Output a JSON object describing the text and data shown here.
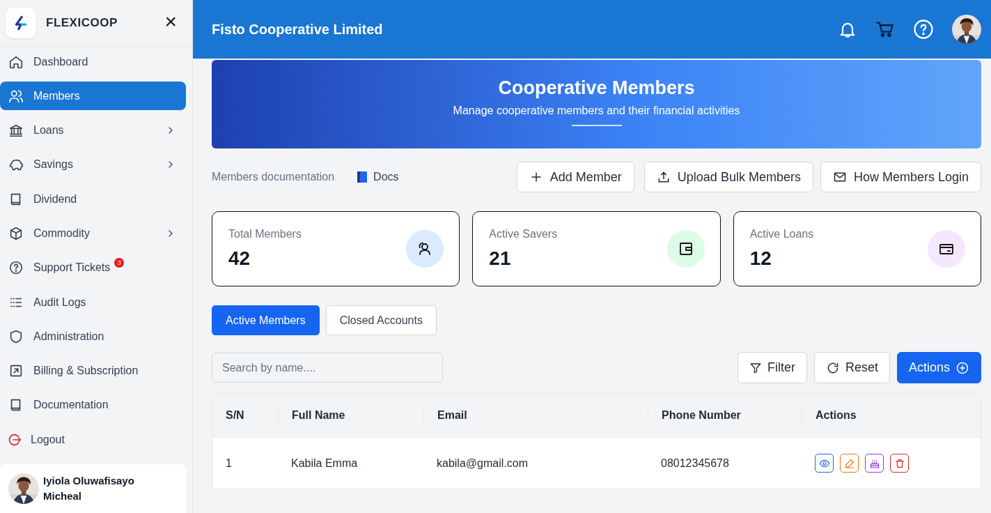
{
  "sidebar": {
    "brand": "FLEXICOOP",
    "close": "×",
    "items": [
      {
        "label": "Dashboard",
        "kind": "link",
        "selected": false,
        "submenu": false
      },
      {
        "label": "Members",
        "kind": "link",
        "selected": true,
        "submenu": false
      },
      {
        "label": "Loans",
        "kind": "link",
        "selected": false,
        "submenu": true
      },
      {
        "label": "Savings",
        "kind": "link",
        "selected": false,
        "submenu": true
      },
      {
        "label": "Dividend",
        "kind": "link",
        "selected": false,
        "submenu": false
      },
      {
        "label": "Commodity",
        "kind": "link",
        "selected": false,
        "submenu": true
      },
      {
        "label": "Support Tickets",
        "kind": "link",
        "selected": false,
        "submenu": false,
        "badge": "3"
      },
      {
        "label": "Audit Logs",
        "kind": "link",
        "selected": false,
        "submenu": false
      },
      {
        "label": "Administration",
        "kind": "link",
        "selected": false,
        "submenu": false
      },
      {
        "label": "Billing & Subscription",
        "kind": "link",
        "selected": false,
        "submenu": false
      },
      {
        "label": "Documentation",
        "kind": "link",
        "selected": false,
        "submenu": false
      },
      {
        "label": "Logout",
        "kind": "logout",
        "selected": false,
        "submenu": false
      }
    ],
    "user": {
      "name": "Iyiola Oluwafisayo Micheal"
    }
  },
  "header": {
    "title": "Fisto Cooperative Limited"
  },
  "banner": {
    "title": "Cooperative Members",
    "subtitle": "Manage cooperative members and their financial activities"
  },
  "docs": {
    "label": "Members documentation",
    "link": "Docs"
  },
  "buttons": [
    "Add Member",
    "Upload Bulk Members",
    "How Members Login"
  ],
  "stats": [
    {
      "label": "Total Members",
      "value": "42",
      "color": "#dbeafe"
    },
    {
      "label": "Active Savers",
      "value": "21",
      "color": "#dcfce7"
    },
    {
      "label": "Active Loans",
      "value": "12",
      "color": "#f3e8ff"
    }
  ],
  "tabs": [
    {
      "label": "Active Members",
      "selected": true
    },
    {
      "label": "Closed Accounts",
      "selected": false
    }
  ],
  "search": {
    "placeholder": "Search by name...."
  },
  "toolbar": {
    "filter": "Filter",
    "reset": "Reset",
    "actions": "Actions"
  },
  "table": {
    "columns": [
      "S/N",
      "Full Name",
      "Email",
      "Phone Number",
      "Actions"
    ],
    "rows": [
      [
        "1",
        "Kabila Emma",
        "kabila@gmail.com",
        "08012345678"
      ]
    ]
  }
}
